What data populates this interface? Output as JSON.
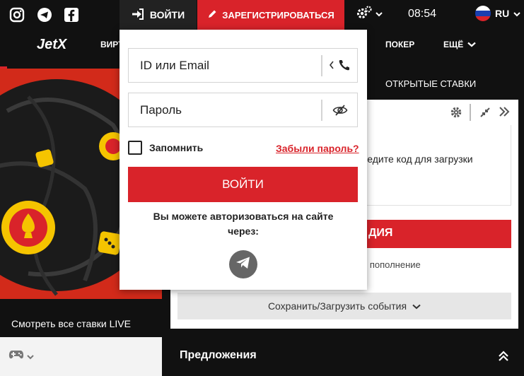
{
  "topbar": {
    "login_label": "ВОЙТИ",
    "register_label": "ЗАРЕГИСТРИРОВАТЬСЯ",
    "time": "08:54",
    "lang": "RU",
    "icons": [
      "instagram-icon",
      "telegram-icon",
      "facebook-icon",
      "settings-icon",
      "russia-flag-icon"
    ]
  },
  "nav": {
    "logo": "JetX",
    "items": [
      "ВИРТ",
      "ПОКЕР",
      "ЕЩЁ"
    ]
  },
  "login": {
    "id_placeholder": "ID или Email",
    "password_placeholder": "Пароль",
    "remember_label": "Запомнить",
    "forgot_label": "Забыли пароль?",
    "submit_label": "ВОЙТИ",
    "social_text": "Вы можете авторизоваться на сайте через:"
  },
  "left": {
    "live_label": "Смотреть все ставки LIVE"
  },
  "right": {
    "open_bets_label": "ОТКРЫТЫЕ СТАВКИ",
    "hint_text": "ведите код для загрузки",
    "register_partial": "ДИЯ",
    "bonus_text": "е пополнение",
    "save_load_label": "Сохранить/Загрузить события",
    "offers_title": "Предложения"
  },
  "colors": {
    "accent_red": "#d9232a",
    "dark": "#111111"
  }
}
